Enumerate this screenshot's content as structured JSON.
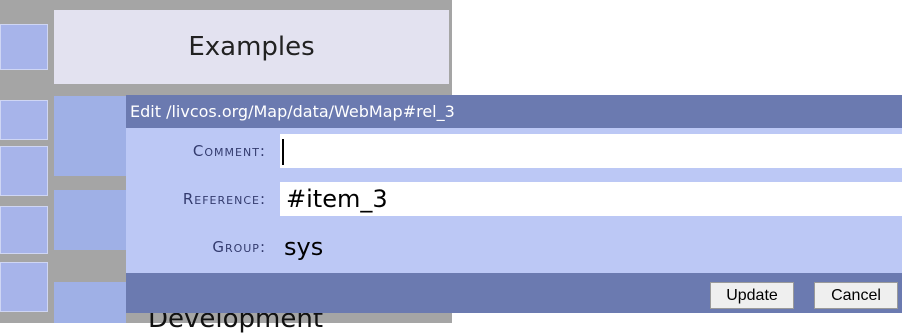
{
  "background": {
    "tab_label": "Examples",
    "partial_label": "Development"
  },
  "dialog": {
    "title": "Edit /livcos.org/Map/data/WebMap#rel_3",
    "fields": [
      {
        "label": "Comment:",
        "value": ""
      },
      {
        "label": "Reference:",
        "value": "#item_3"
      },
      {
        "label": "Group:",
        "value": "sys"
      }
    ],
    "buttons": {
      "update": "Update",
      "cancel": "Cancel"
    }
  },
  "colors": {
    "title_bar": "#6b7ab0",
    "dialog_body": "#bcc8f5",
    "background_blue": "#9fb0e6",
    "tab_background": "#e3e2f0"
  }
}
